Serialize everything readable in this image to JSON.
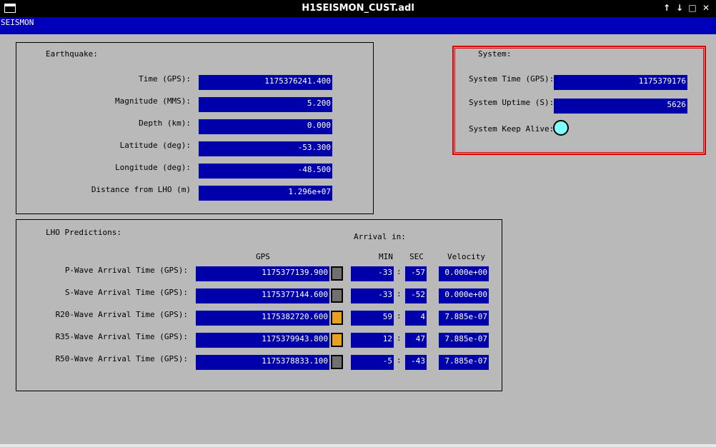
{
  "window": {
    "title": "H1SEISMON_CUST.adl",
    "buttons": [
      "↑",
      "↓",
      "□",
      "✕"
    ]
  },
  "menubar": {
    "label": "SEISMON"
  },
  "earthquake": {
    "heading": "Earthquake:",
    "rows": [
      {
        "label": "Time (GPS):",
        "value": "1175376241.400"
      },
      {
        "label": "Magnitude (MMS):",
        "value": "5.200"
      },
      {
        "label": "Depth (km):",
        "value": "0.000"
      },
      {
        "label": "Latitude (deg):",
        "value": "-53.300"
      },
      {
        "label": "Longitude (deg):",
        "value": "-48.500"
      },
      {
        "label": "Distance from LHO (m)",
        "value": "1.296e+07"
      }
    ]
  },
  "system": {
    "heading": "System:",
    "time_label": "System Time (GPS):",
    "time_value": "1175379176",
    "uptime_label": "System Uptime (S):",
    "uptime_value": "5626",
    "keepalive_label": "System Keep Alive:",
    "keepalive_color": "#80ffff",
    "border_color": "#dd0000"
  },
  "predictions": {
    "heading": "LHO Predictions:",
    "arrival_heading": "Arrival in:",
    "col_gps": "GPS",
    "col_min": "MIN",
    "col_sec": "SEC",
    "col_velocity": "Velocity",
    "colon": ":",
    "rows": [
      {
        "label": "P-Wave Arrival Time (GPS):",
        "gps": "1175377139.900",
        "status": "#707070",
        "min": "-33",
        "sec": "-57",
        "velocity": "0.000e+00"
      },
      {
        "label": "S-Wave Arrival Time (GPS):",
        "gps": "1175377144.600",
        "status": "#707070",
        "min": "-33",
        "sec": "-52",
        "velocity": "0.000e+00"
      },
      {
        "label": "R20-Wave Arrival Time (GPS):",
        "gps": "1175382720.600",
        "status": "#e8a020",
        "min": "59",
        "sec": "4",
        "velocity": "7.885e-07"
      },
      {
        "label": "R35-Wave Arrival Time (GPS):",
        "gps": "1175379943.800",
        "status": "#e8a020",
        "min": "12",
        "sec": "47",
        "velocity": "7.885e-07"
      },
      {
        "label": "R50-Wave Arrival Time (GPS):",
        "gps": "1175378833.100",
        "status": "#707070",
        "min": "-5",
        "sec": "-43",
        "velocity": "7.885e-07"
      }
    ]
  }
}
